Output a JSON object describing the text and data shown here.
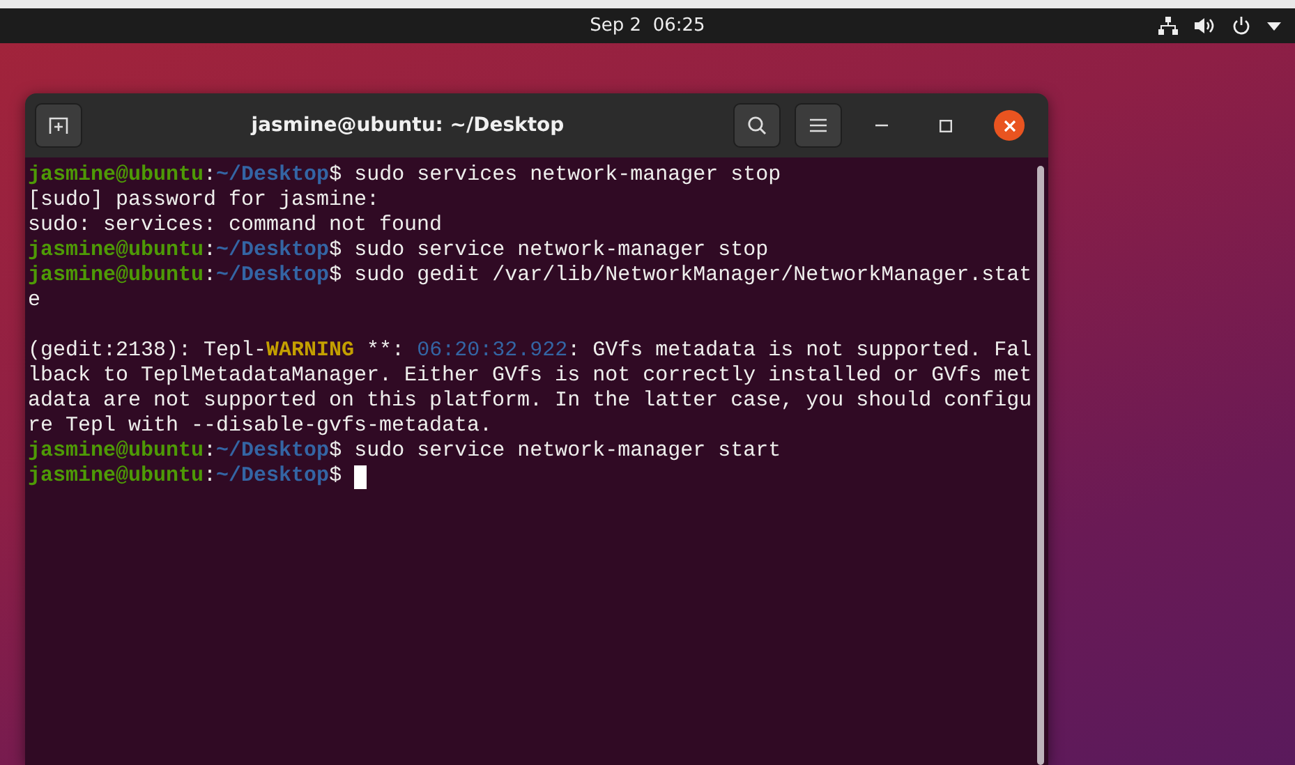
{
  "top_bar": {
    "clock": "Sep 2  06:25"
  },
  "window": {
    "title": "jasmine@ubuntu: ~/Desktop"
  },
  "terminal": {
    "cursor": true,
    "lines": [
      {
        "segments": [
          {
            "kind": "user",
            "text": "jasmine@ubuntu"
          },
          {
            "kind": "plain",
            "text": ":"
          },
          {
            "kind": "path",
            "text": "~/Desktop"
          },
          {
            "kind": "plain",
            "text": "$ sudo services network-manager stop"
          }
        ]
      },
      {
        "segments": [
          {
            "kind": "plain",
            "text": "[sudo] password for jasmine:"
          }
        ]
      },
      {
        "segments": [
          {
            "kind": "plain",
            "text": "sudo: services: command not found"
          }
        ]
      },
      {
        "segments": [
          {
            "kind": "user",
            "text": "jasmine@ubuntu"
          },
          {
            "kind": "plain",
            "text": ":"
          },
          {
            "kind": "path",
            "text": "~/Desktop"
          },
          {
            "kind": "plain",
            "text": "$ sudo service network-manager stop"
          }
        ]
      },
      {
        "segments": [
          {
            "kind": "user",
            "text": "jasmine@ubuntu"
          },
          {
            "kind": "plain",
            "text": ":"
          },
          {
            "kind": "path",
            "text": "~/Desktop"
          },
          {
            "kind": "plain",
            "text": "$ sudo gedit /var/lib/NetworkManager/NetworkManager.stat"
          }
        ]
      },
      {
        "segments": [
          {
            "kind": "plain",
            "text": "e"
          }
        ]
      },
      {
        "gap_before": true,
        "segments": [
          {
            "kind": "plain",
            "text": "(gedit:2138): Tepl-"
          },
          {
            "kind": "warning",
            "text": "WARNING"
          },
          {
            "kind": "plain",
            "text": " **: "
          },
          {
            "kind": "time",
            "text": "06:20:32.922"
          },
          {
            "kind": "plain",
            "text": ": GVfs metadata is not supported. Fal"
          }
        ]
      },
      {
        "segments": [
          {
            "kind": "plain",
            "text": "lback to TeplMetadataManager. Either GVfs is not correctly installed or GVfs met"
          }
        ]
      },
      {
        "segments": [
          {
            "kind": "plain",
            "text": "adata are not supported on this platform. In the latter case, you should configu"
          }
        ]
      },
      {
        "segments": [
          {
            "kind": "plain",
            "text": "re Tepl with --disable-gvfs-metadata."
          }
        ]
      },
      {
        "segments": [
          {
            "kind": "user",
            "text": "jasmine@ubuntu"
          },
          {
            "kind": "plain",
            "text": ":"
          },
          {
            "kind": "path",
            "text": "~/Desktop"
          },
          {
            "kind": "plain",
            "text": "$ sudo service network-manager start"
          }
        ]
      },
      {
        "segments": [
          {
            "kind": "user",
            "text": "jasmine@ubuntu"
          },
          {
            "kind": "plain",
            "text": ":"
          },
          {
            "kind": "path",
            "text": "~/Desktop"
          },
          {
            "kind": "plain",
            "text": "$ "
          }
        ]
      }
    ]
  }
}
